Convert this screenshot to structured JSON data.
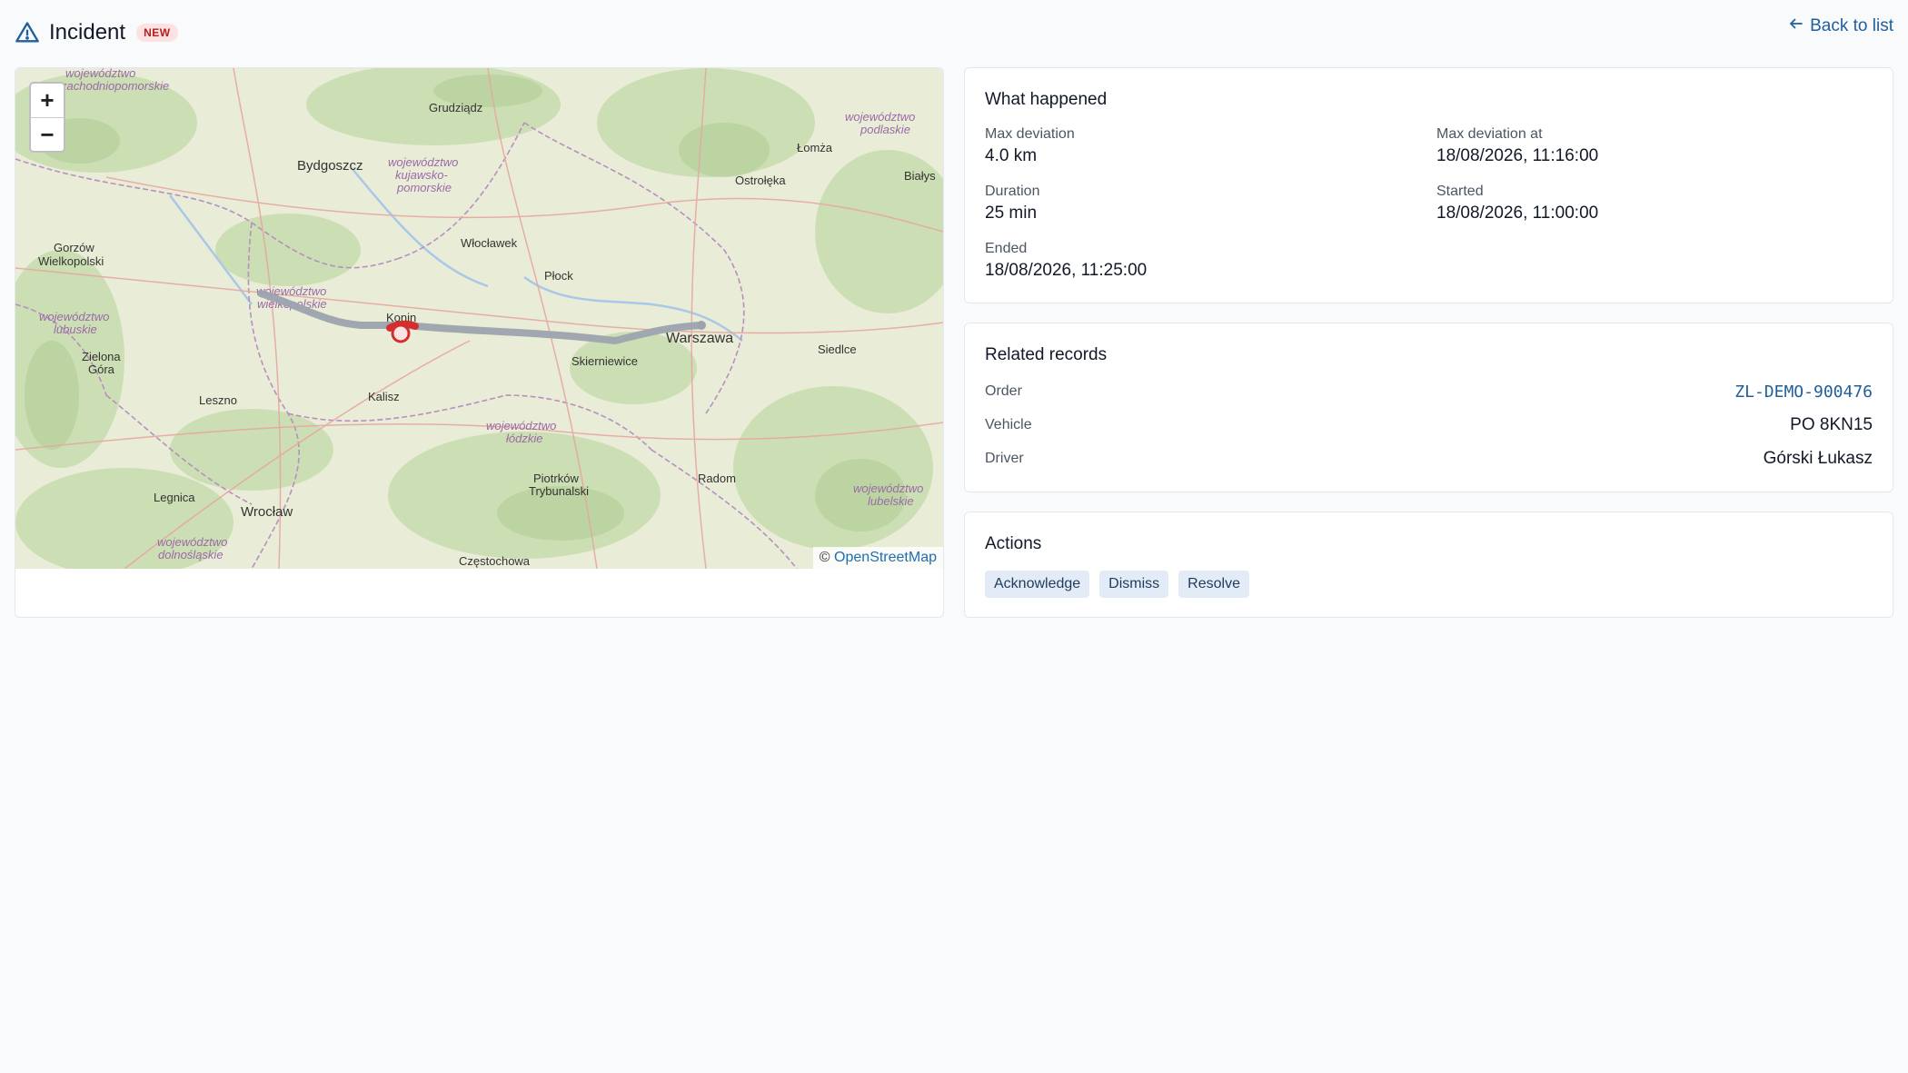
{
  "header": {
    "title": "Incident",
    "badge": "NEW",
    "back_label": "Back to list"
  },
  "map": {
    "zoom_in": "+",
    "zoom_out": "−",
    "attribution_prefix": "©",
    "attribution_link": "OpenStreetMap",
    "labels": [
      "Grudziądz",
      "Bydgoszcz",
      "Łomża",
      "Ostrołęka",
      "Białys",
      "Gorzów Wielkopolski",
      "Włocławek",
      "Płock",
      "Konin",
      "Warszawa",
      "Siedlce",
      "Skierniewice",
      "Zielona Góra",
      "Leszno",
      "Kalisz",
      "Piotrków Trybunalski",
      "Radom",
      "Legnica",
      "Wrocław",
      "Częstochowa",
      "województwo zachodniopomorskie",
      "województwo kujawsko-pomorskie",
      "województwo podlaskie",
      "województwo wielkopolskie",
      "województwo lubuskie",
      "województwo łódzkie",
      "województwo lubelskie",
      "województwo dolnośląskie"
    ]
  },
  "what_happened": {
    "title": "What happened",
    "fields": [
      {
        "label": "Max deviation",
        "value": "4.0 km"
      },
      {
        "label": "Max deviation at",
        "value": "18/08/2026, 11:16:00"
      },
      {
        "label": "Duration",
        "value": "25 min"
      },
      {
        "label": "Started",
        "value": "18/08/2026, 11:00:00"
      },
      {
        "label": "Ended",
        "value": "18/08/2026, 11:25:00"
      }
    ]
  },
  "related": {
    "title": "Related records",
    "rows": [
      {
        "label": "Order",
        "value": "ZL-DEMO-900476"
      },
      {
        "label": "Vehicle",
        "value": "PO 8KN15"
      },
      {
        "label": "Driver",
        "value": "Górski Łukasz"
      }
    ]
  },
  "actions": {
    "title": "Actions",
    "buttons": [
      "Acknowledge",
      "Dismiss",
      "Resolve"
    ]
  },
  "colors": {
    "accent": "#1f5f9b",
    "route": "#9ca3af",
    "deviation": "#d32f2f",
    "badge_text": "#b91c1c",
    "badge_bg": "#fde2e2"
  },
  "icons": [
    "alert-triangle-icon",
    "arrow-left-icon"
  ]
}
